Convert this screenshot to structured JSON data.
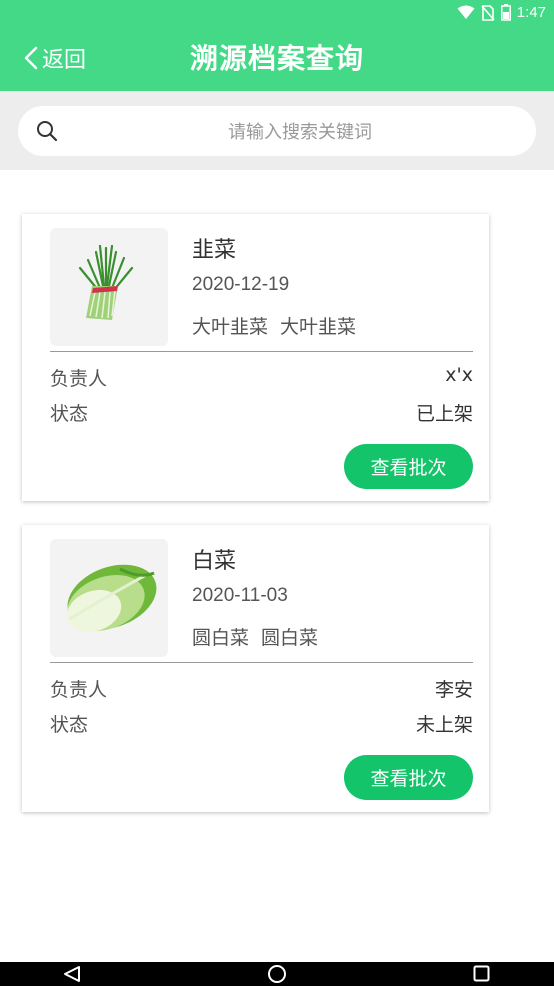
{
  "status_bar": {
    "time": "1:47"
  },
  "header": {
    "back_label": "返回",
    "title": "溯源档案查询"
  },
  "search": {
    "placeholder": "请输入搜索关键词"
  },
  "cards": [
    {
      "name": "韭菜",
      "date": "2020-12-19",
      "tags": [
        "大叶韭菜",
        "大叶韭菜"
      ],
      "owner_label": "负责人",
      "owner": "x'x",
      "status_label": "状态",
      "status": "已上架",
      "button": "查看批次"
    },
    {
      "name": "白菜",
      "date": "2020-11-03",
      "tags": [
        "圆白菜",
        "圆白菜"
      ],
      "owner_label": "负责人",
      "owner": "李安",
      "status_label": "状态",
      "status": "未上架",
      "button": "查看批次"
    }
  ],
  "colors": {
    "brand": "#43d987",
    "button": "#13c46a",
    "search_bg": "#ededed"
  },
  "icons": [
    "wifi-icon",
    "no-sim-icon",
    "battery-icon",
    "back-chevron-icon",
    "search-icon",
    "nav-back-icon",
    "nav-home-icon",
    "nav-recents-icon"
  ]
}
